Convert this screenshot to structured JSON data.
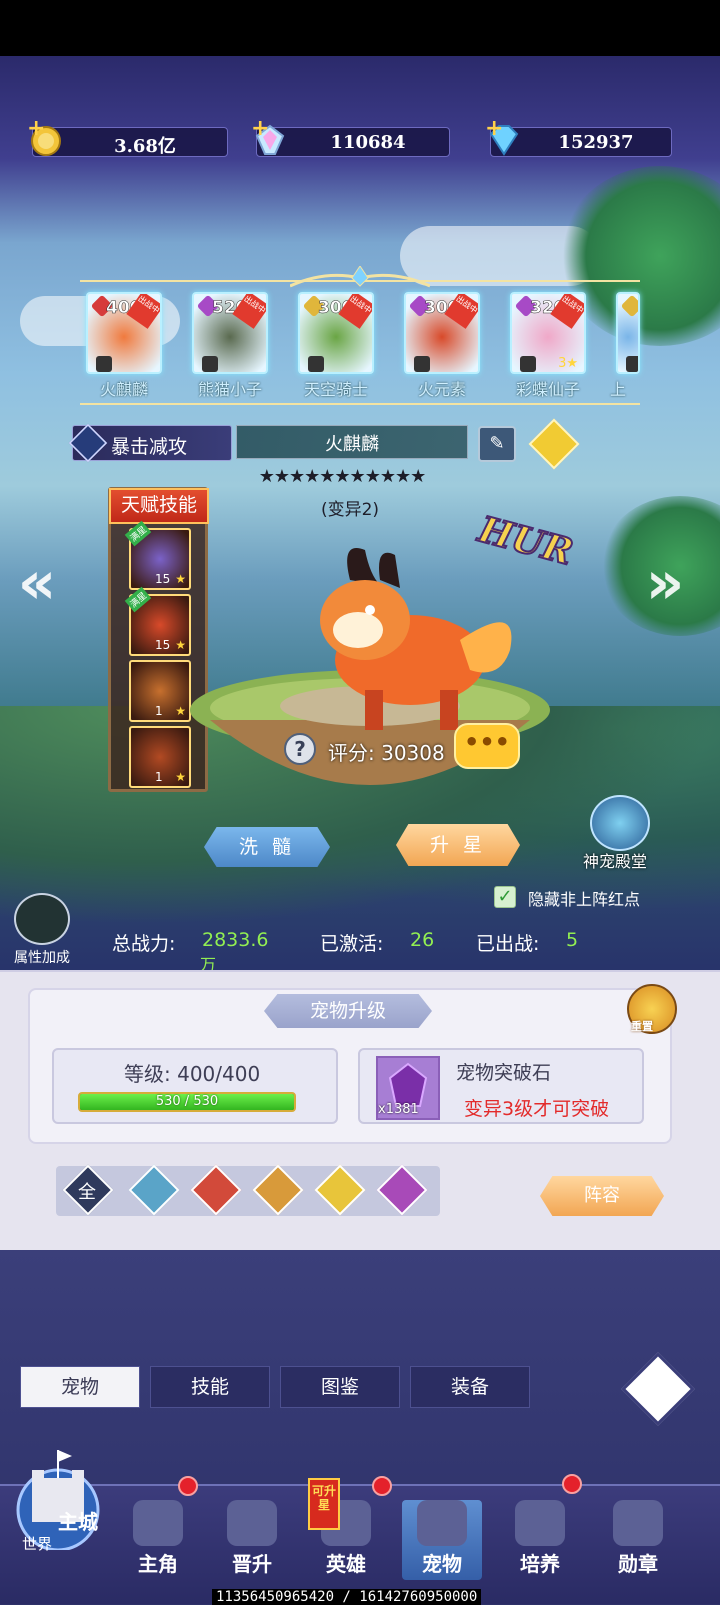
{
  "resources": [
    {
      "icon": "gold-coin-icon",
      "value": "3.68亿"
    },
    {
      "icon": "rainbow-crystal-icon",
      "value": "110684"
    },
    {
      "icon": "blue-diamond-icon",
      "value": "152937"
    }
  ],
  "pets": [
    {
      "level": "400",
      "name": "火麒麟",
      "badge": "出战中",
      "color": "#f07a3e",
      "element": "#d63b3b"
    },
    {
      "level": "520",
      "name": "熊猫小子",
      "badge": "出战中",
      "color": "#5a6a4f",
      "element": "#a74ac6"
    },
    {
      "level": "300",
      "name": "天空骑士",
      "badge": "出战中",
      "color": "#6aa544",
      "element": "#e0b63b"
    },
    {
      "level": "300",
      "name": "火元素",
      "badge": "出战中",
      "color": "#d84a2a",
      "element": "#a74ac6"
    },
    {
      "level": "320",
      "name": "彩蝶仙子",
      "badge": "出战中",
      "color": "#f0a8c8",
      "element": "#a74ac6",
      "stars": "3"
    },
    {
      "level": "",
      "name": "上",
      "badge": "",
      "color": "#7ab5e8",
      "element": "#e0b63b"
    }
  ],
  "pet_detail": {
    "skill_banner": "暴击减攻",
    "name": "火麒麟",
    "stars": "★★★★★★★★★★★",
    "mutation": "(变异2)",
    "rarity": "HUR",
    "score_label": "评分:",
    "score_value": "30308",
    "chat_dots": "•••"
  },
  "talent": {
    "title": "天赋技能",
    "skills": [
      {
        "level": "15",
        "tag": "满星",
        "color": "#7b62c9"
      },
      {
        "level": "15",
        "tag": "满星",
        "color": "#d84a2a"
      },
      {
        "level": "1",
        "tag": "",
        "color": "#c7702e"
      },
      {
        "level": "1",
        "tag": "",
        "color": "#b24a23"
      }
    ]
  },
  "actions": {
    "wash": "洗 髓",
    "star_up": "升 星",
    "temple": "神宠殿堂",
    "hide_label": "隐藏非上阵红点",
    "hide_checked": "✓"
  },
  "attr": {
    "label": "属性加成"
  },
  "stats": {
    "power_label": "总战力:",
    "power_value": "2833.6",
    "power_unit": "万",
    "activated_label": "已激活:",
    "activated_value": "26",
    "deployed_label": "已出战:",
    "deployed_value": "5"
  },
  "upgrade": {
    "title": "宠物升级",
    "reset_label": "重置",
    "level_text": "等级: 400/400",
    "exp_text": "530 / 530",
    "exp_fraction": 1.0,
    "stone_name": "宠物突破石",
    "stone_count": "x1381",
    "stone_requirement": "变异3级才可突破"
  },
  "filters": {
    "all": "全",
    "items": [
      {
        "icon": "water-element-icon",
        "color": "#5aa4c8"
      },
      {
        "icon": "fire-element-icon",
        "color": "#d24a3a"
      },
      {
        "icon": "earth-element-icon",
        "color": "#d89a3a"
      },
      {
        "icon": "light-element-icon",
        "color": "#e8c53a"
      },
      {
        "icon": "dark-element-icon",
        "color": "#a84ab8"
      }
    ],
    "formation": "阵容"
  },
  "tabs": [
    "宠物",
    "技能",
    "图鉴",
    "装备"
  ],
  "nav": {
    "castle_label": "主城",
    "world_label": "世界",
    "items": [
      "主角",
      "晋升",
      "英雄",
      "宠物",
      "培养",
      "勋章"
    ],
    "can_upgrade": "可升星"
  },
  "debug": "11356450965420 / 16142760950000"
}
